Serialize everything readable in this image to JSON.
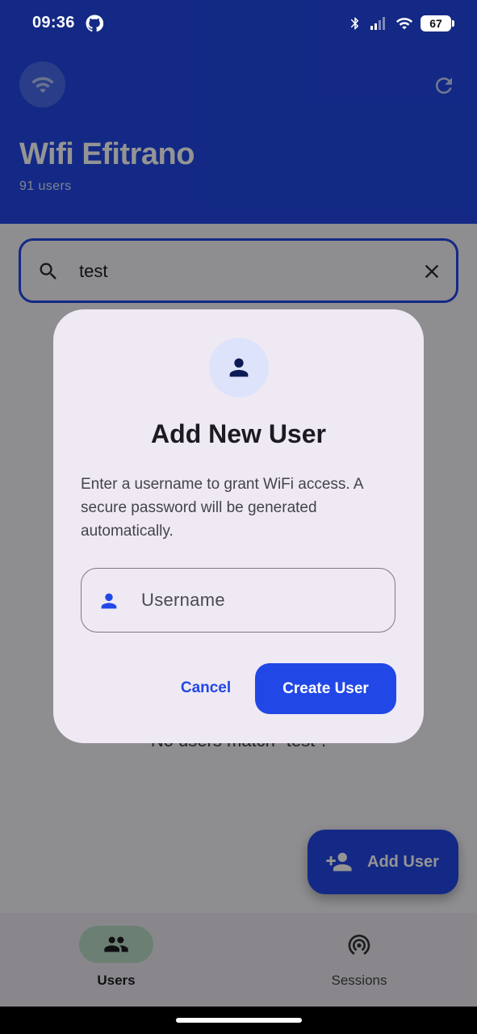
{
  "status_bar": {
    "time": "09:36",
    "battery": "67"
  },
  "header": {
    "title": "Wifi Efitrano",
    "subtitle": "91 users"
  },
  "search": {
    "value": "test"
  },
  "empty_message": "No users match \"test\".",
  "fab": {
    "label": "Add User"
  },
  "bottom_nav": {
    "items": [
      {
        "label": "Users",
        "active": true
      },
      {
        "label": "Sessions",
        "active": false
      }
    ]
  },
  "dialog": {
    "title": "Add New User",
    "body": "Enter a username to grant WiFi access. A secure password will be generated automatically.",
    "username_placeholder": "Username",
    "cancel_label": "Cancel",
    "create_label": "Create User"
  },
  "colors": {
    "primary": "#2148e6",
    "surface": "#efe9f3",
    "nav_active": "#b8dcc4"
  },
  "icons": {
    "status": [
      "github-icon",
      "bluetooth-icon",
      "signal-icon",
      "wifi-icon",
      "battery-icon"
    ],
    "header": [
      "wifi-icon",
      "refresh-icon"
    ],
    "search": [
      "search-icon",
      "close-icon"
    ],
    "dialog": [
      "person-icon"
    ],
    "fab": "person-add-icon",
    "nav": [
      "people-icon",
      "sensors-icon"
    ]
  }
}
